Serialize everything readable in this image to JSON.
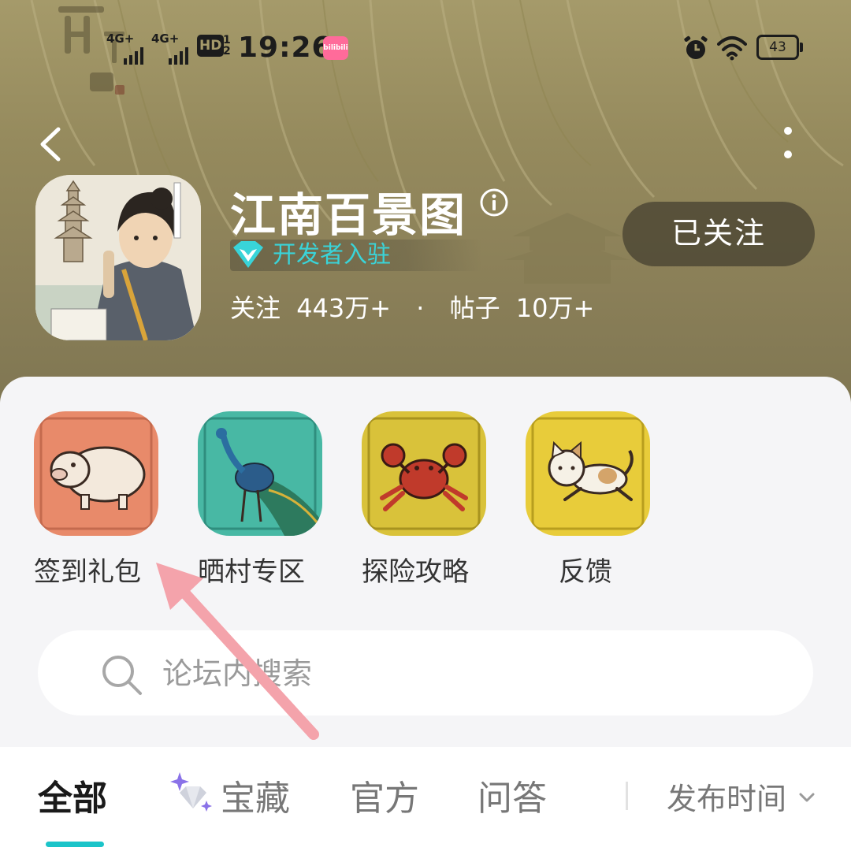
{
  "status_bar": {
    "signal1": "4G+",
    "signal2": "4G+",
    "hd_label": "HD",
    "hd_sub": "1 2",
    "time": "19:26",
    "bili_label": "bilibili",
    "battery": "43"
  },
  "icons": {
    "back": "chevron-left-icon",
    "more": "more-vertical-icon",
    "info": "info-icon",
    "developer": "diamond-icon",
    "search": "search-icon",
    "treasure": "sparkle-diamond-icon",
    "sort": "chevron-down-icon"
  },
  "colors": {
    "accent": "#1bc4c9",
    "developer_text": "#39d4d9",
    "hero_bg": "#958a5d",
    "annotation_arrow": "#f4a3ab"
  },
  "game": {
    "title": "江南百景图",
    "developer_badge": "开发者入驻",
    "followers_label": "关注",
    "followers_value": "443万+",
    "separator": "·",
    "posts_label": "帖子",
    "posts_value": "10万+",
    "follow_button": "已关注"
  },
  "shortcuts": [
    {
      "label": "签到礼包",
      "icon": "pig-icon"
    },
    {
      "label": "晒村专区",
      "icon": "peacock-icon"
    },
    {
      "label": "探险攻略",
      "icon": "crab-icon"
    },
    {
      "label": "反馈",
      "icon": "cat-icon"
    }
  ],
  "search": {
    "placeholder": "论坛内搜索"
  },
  "tabs": [
    {
      "label": "全部",
      "active": true
    },
    {
      "label": "宝藏",
      "active": false
    },
    {
      "label": "官方",
      "active": false
    },
    {
      "label": "问答",
      "active": false
    }
  ],
  "sort": {
    "label": "发布时间"
  }
}
